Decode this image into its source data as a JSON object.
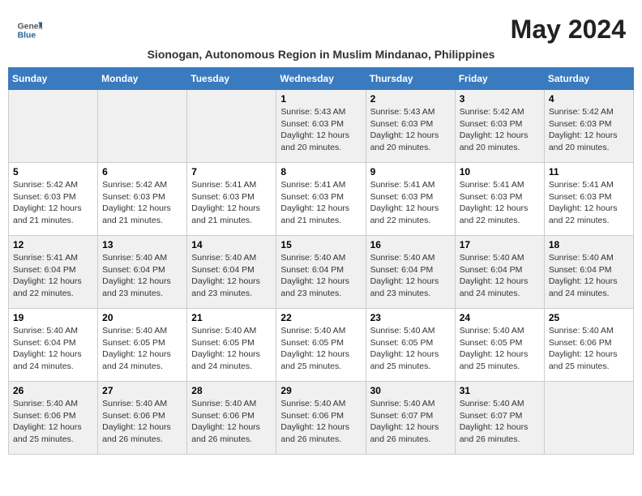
{
  "header": {
    "logo_line1": "General",
    "logo_line2": "Blue",
    "month_title": "May 2024",
    "subtitle": "Sionogan, Autonomous Region in Muslim Mindanao, Philippines"
  },
  "days_of_week": [
    "Sunday",
    "Monday",
    "Tuesday",
    "Wednesday",
    "Thursday",
    "Friday",
    "Saturday"
  ],
  "weeks": [
    [
      {
        "day": "",
        "info": ""
      },
      {
        "day": "",
        "info": ""
      },
      {
        "day": "",
        "info": ""
      },
      {
        "day": "1",
        "info": "Sunrise: 5:43 AM\nSunset: 6:03 PM\nDaylight: 12 hours\nand 20 minutes."
      },
      {
        "day": "2",
        "info": "Sunrise: 5:43 AM\nSunset: 6:03 PM\nDaylight: 12 hours\nand 20 minutes."
      },
      {
        "day": "3",
        "info": "Sunrise: 5:42 AM\nSunset: 6:03 PM\nDaylight: 12 hours\nand 20 minutes."
      },
      {
        "day": "4",
        "info": "Sunrise: 5:42 AM\nSunset: 6:03 PM\nDaylight: 12 hours\nand 20 minutes."
      }
    ],
    [
      {
        "day": "5",
        "info": "Sunrise: 5:42 AM\nSunset: 6:03 PM\nDaylight: 12 hours\nand 21 minutes."
      },
      {
        "day": "6",
        "info": "Sunrise: 5:42 AM\nSunset: 6:03 PM\nDaylight: 12 hours\nand 21 minutes."
      },
      {
        "day": "7",
        "info": "Sunrise: 5:41 AM\nSunset: 6:03 PM\nDaylight: 12 hours\nand 21 minutes."
      },
      {
        "day": "8",
        "info": "Sunrise: 5:41 AM\nSunset: 6:03 PM\nDaylight: 12 hours\nand 21 minutes."
      },
      {
        "day": "9",
        "info": "Sunrise: 5:41 AM\nSunset: 6:03 PM\nDaylight: 12 hours\nand 22 minutes."
      },
      {
        "day": "10",
        "info": "Sunrise: 5:41 AM\nSunset: 6:03 PM\nDaylight: 12 hours\nand 22 minutes."
      },
      {
        "day": "11",
        "info": "Sunrise: 5:41 AM\nSunset: 6:03 PM\nDaylight: 12 hours\nand 22 minutes."
      }
    ],
    [
      {
        "day": "12",
        "info": "Sunrise: 5:41 AM\nSunset: 6:04 PM\nDaylight: 12 hours\nand 22 minutes."
      },
      {
        "day": "13",
        "info": "Sunrise: 5:40 AM\nSunset: 6:04 PM\nDaylight: 12 hours\nand 23 minutes."
      },
      {
        "day": "14",
        "info": "Sunrise: 5:40 AM\nSunset: 6:04 PM\nDaylight: 12 hours\nand 23 minutes."
      },
      {
        "day": "15",
        "info": "Sunrise: 5:40 AM\nSunset: 6:04 PM\nDaylight: 12 hours\nand 23 minutes."
      },
      {
        "day": "16",
        "info": "Sunrise: 5:40 AM\nSunset: 6:04 PM\nDaylight: 12 hours\nand 23 minutes."
      },
      {
        "day": "17",
        "info": "Sunrise: 5:40 AM\nSunset: 6:04 PM\nDaylight: 12 hours\nand 24 minutes."
      },
      {
        "day": "18",
        "info": "Sunrise: 5:40 AM\nSunset: 6:04 PM\nDaylight: 12 hours\nand 24 minutes."
      }
    ],
    [
      {
        "day": "19",
        "info": "Sunrise: 5:40 AM\nSunset: 6:04 PM\nDaylight: 12 hours\nand 24 minutes."
      },
      {
        "day": "20",
        "info": "Sunrise: 5:40 AM\nSunset: 6:05 PM\nDaylight: 12 hours\nand 24 minutes."
      },
      {
        "day": "21",
        "info": "Sunrise: 5:40 AM\nSunset: 6:05 PM\nDaylight: 12 hours\nand 24 minutes."
      },
      {
        "day": "22",
        "info": "Sunrise: 5:40 AM\nSunset: 6:05 PM\nDaylight: 12 hours\nand 25 minutes."
      },
      {
        "day": "23",
        "info": "Sunrise: 5:40 AM\nSunset: 6:05 PM\nDaylight: 12 hours\nand 25 minutes."
      },
      {
        "day": "24",
        "info": "Sunrise: 5:40 AM\nSunset: 6:05 PM\nDaylight: 12 hours\nand 25 minutes."
      },
      {
        "day": "25",
        "info": "Sunrise: 5:40 AM\nSunset: 6:06 PM\nDaylight: 12 hours\nand 25 minutes."
      }
    ],
    [
      {
        "day": "26",
        "info": "Sunrise: 5:40 AM\nSunset: 6:06 PM\nDaylight: 12 hours\nand 25 minutes."
      },
      {
        "day": "27",
        "info": "Sunrise: 5:40 AM\nSunset: 6:06 PM\nDaylight: 12 hours\nand 26 minutes."
      },
      {
        "day": "28",
        "info": "Sunrise: 5:40 AM\nSunset: 6:06 PM\nDaylight: 12 hours\nand 26 minutes."
      },
      {
        "day": "29",
        "info": "Sunrise: 5:40 AM\nSunset: 6:06 PM\nDaylight: 12 hours\nand 26 minutes."
      },
      {
        "day": "30",
        "info": "Sunrise: 5:40 AM\nSunset: 6:07 PM\nDaylight: 12 hours\nand 26 minutes."
      },
      {
        "day": "31",
        "info": "Sunrise: 5:40 AM\nSunset: 6:07 PM\nDaylight: 12 hours\nand 26 minutes."
      },
      {
        "day": "",
        "info": ""
      }
    ]
  ]
}
